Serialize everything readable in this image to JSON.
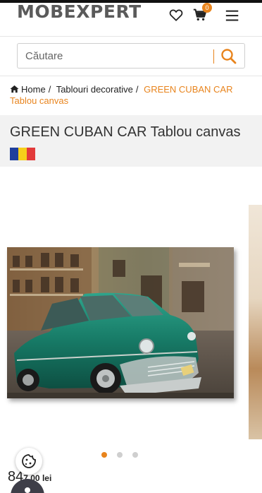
{
  "header": {
    "logo": "MOBEXPERT",
    "cart_count": "0",
    "icons": {
      "wishlist": "heart-icon",
      "cart": "cart-icon",
      "menu": "hamburger-menu-icon"
    }
  },
  "search": {
    "placeholder": "Căutare",
    "icon": "search-icon"
  },
  "breadcrumb": {
    "items": [
      "Home",
      "Tablouri decorative",
      "GREEN CUBAN CAR Tablou canvas"
    ],
    "separator": "/"
  },
  "product": {
    "title": "GREEN CUBAN CAR Tablou canvas",
    "flag_colors": [
      "#1f3f9c",
      "#f6cf1a",
      "#e23a3a"
    ],
    "price_visible_prefix": "84",
    "price_visible_suffix": "7,00 lei"
  },
  "carousel": {
    "slide_count": 3,
    "active_index": 0
  },
  "colors": {
    "accent": "#e8841d",
    "text": "#333333",
    "band": "#f2f2f2"
  }
}
